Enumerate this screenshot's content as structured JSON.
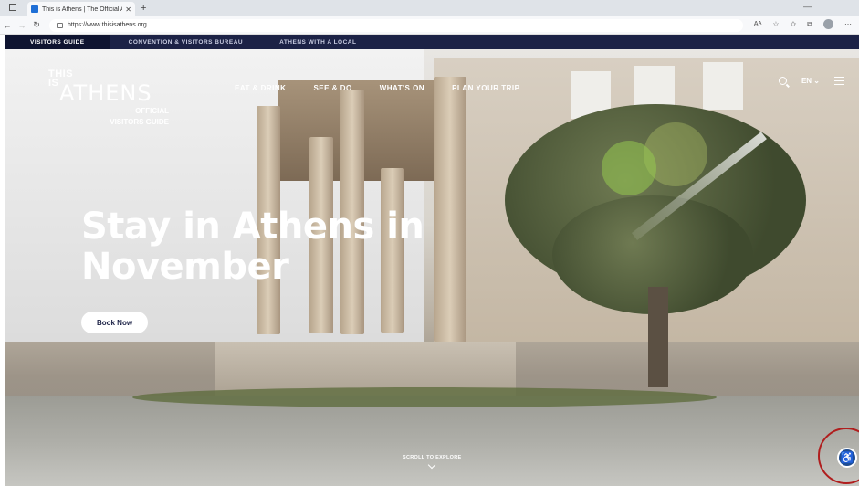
{
  "browser": {
    "tab_title": "This is Athens | The Official Athe",
    "url": "https://www.thisisathens.org"
  },
  "topstrip": {
    "items": [
      "VISITORS GUIDE",
      "CONVENTION & VISITORS BUREAU",
      "ATHENS WITH A LOCAL"
    ]
  },
  "logo": {
    "line1": "THIS",
    "line2": "IS",
    "brand": "ATHENS",
    "sub1": "OFFICIAL",
    "sub2": "VISITORS GUIDE"
  },
  "nav": {
    "items": [
      "EAT & DRINK",
      "SEE & DO",
      "WHAT'S ON",
      "PLAN YOUR TRIP"
    ],
    "language": "EN"
  },
  "hero": {
    "headline_line1": "Stay in Athens in",
    "headline_line2": "November",
    "cta": "Book Now",
    "scroll_label": "SCROLL TO EXPLORE"
  },
  "colors": {
    "navy": "#1c2246",
    "accessibility": "#1f4c8f",
    "highlight_ring": "#b01e1e"
  },
  "icons": [
    "search-icon",
    "hamburger-menu-icon",
    "accessibility-icon",
    "chevron-down-icon"
  ]
}
